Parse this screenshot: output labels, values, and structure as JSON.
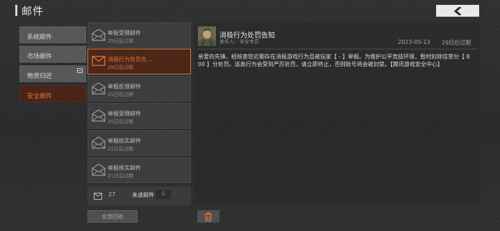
{
  "header": {
    "title": "邮件",
    "back_icon": "chevron-left-icon"
  },
  "categories": [
    {
      "label": "系统邮件",
      "active": false
    },
    {
      "label": "市场邮件",
      "active": false
    },
    {
      "label": "物资归还",
      "active": false,
      "icon": "mailbox-icon"
    },
    {
      "label": "安全邮件",
      "active": true
    }
  ],
  "mail_list": [
    {
      "subject": "举报受理邮件",
      "expire": "29日后过期",
      "read": true
    },
    {
      "subject": "消极行为处罚告...",
      "expire": "29日后过期",
      "read": false,
      "selected": true
    },
    {
      "subject": "举报反馈邮件",
      "expire": "25日后过期",
      "read": true
    },
    {
      "subject": "举报受理邮件",
      "expire": "25日后过期",
      "read": true
    },
    {
      "subject": "举报核实邮件",
      "expire": "21日后过期",
      "read": true
    },
    {
      "subject": "举报核实邮件",
      "expire": "21日后过期",
      "read": true
    }
  ],
  "footer": {
    "total_count": "27",
    "unread_label": "未读邮件",
    "unread_count": "0",
    "collect_all_label": "全部回收"
  },
  "detail": {
    "title": "消极行为处罚告知",
    "sender_label": "发件人：",
    "sender": "安全专员",
    "date": "2023-05-13",
    "expire": "29日后过期",
    "body": "亲爱的先锋，经核查您近期存在消极游戏行为且被玩家【 - 】举报。为维护公平竞技环境，暂时扣除信誉分【 800 】分处罚。该类行为会受到严厉处罚，请立即终止，否则账号将会被封禁。【腾讯游戏安全中心】",
    "delete_icon": "trash-icon"
  },
  "colors": {
    "accent": "#e8743a",
    "active_bg": "#4b2619"
  }
}
